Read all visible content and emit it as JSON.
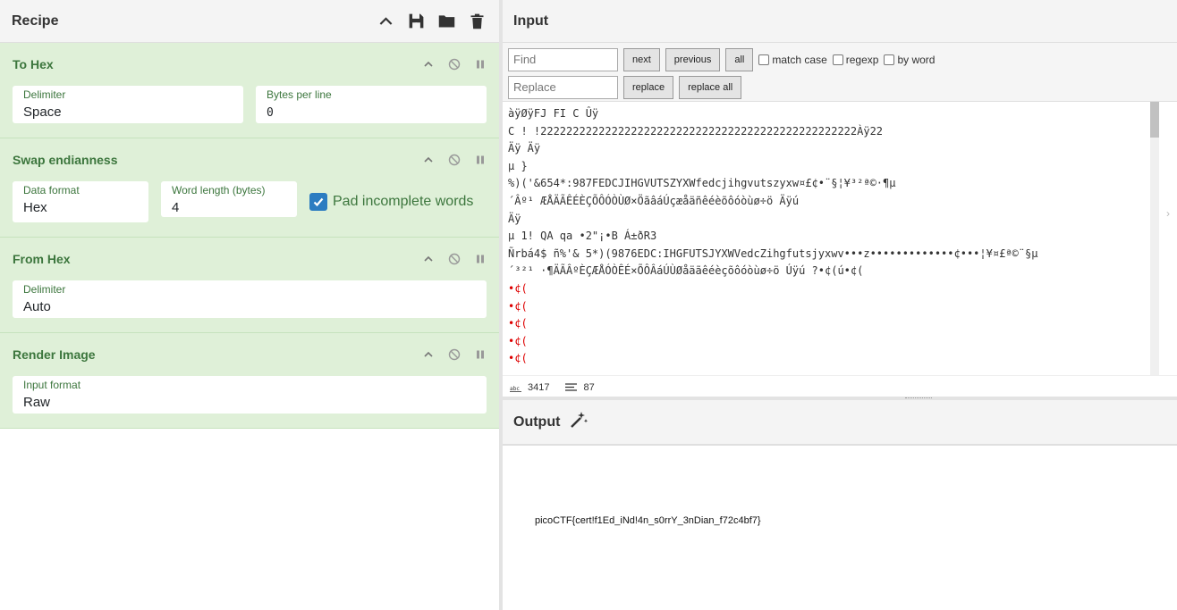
{
  "recipe": {
    "title": "Recipe",
    "icons": [
      "chevron-up-icon",
      "save-icon",
      "folder-icon",
      "trash-icon"
    ],
    "operations": [
      {
        "name": "To Hex",
        "args": [
          {
            "label": "Delimiter",
            "value": "Space"
          },
          {
            "label": "Bytes per line",
            "value": "0"
          }
        ]
      },
      {
        "name": "Swap endianness",
        "args": [
          {
            "label": "Data format",
            "value": "Hex"
          },
          {
            "label": "Word length (bytes)",
            "value": "4"
          }
        ],
        "checkbox": {
          "label": "Pad incomplete words",
          "checked": true
        }
      },
      {
        "name": "From Hex",
        "args": [
          {
            "label": "Delimiter",
            "value": "Auto"
          }
        ]
      },
      {
        "name": "Render Image",
        "args": [
          {
            "label": "Input format",
            "value": "Raw"
          }
        ]
      }
    ]
  },
  "input": {
    "title": "Input",
    "search": {
      "find_placeholder": "Find",
      "replace_placeholder": "Replace",
      "next": "next",
      "previous": "previous",
      "all": "all",
      "match_case": "match case",
      "regexp": "regexp",
      "by_word": "by word",
      "replace": "replace",
      "replace_all": "replace all"
    },
    "lines": [
      "àÿØÿFJ FI C Ûÿ",
      "C ! !2222222222222222222222222222222222222222222222222Àÿ22",
      "Äÿ Äÿ",
      "µ }",
      "%)('&654*:987FEDCJIHGVUTSZYXWfedcjihgvutszyxw¤£¢•¨§¦¥³²ª©·¶µ",
      "´Âº¹ ÆÅÄÃÊÉÈÇÕÔÓÒÙØ×ÖãâáÚçæåäñêéèõôóòùø÷ö Äÿú",
      "Äÿ",
      "µ 1! QA qa •2\"¡•B Á±ðR3",
      "Ñrbá4$ ñ%'& 5*)(9876EDC:IHGFUTSJYXWVedcZihgfutsjyxwv•••z•••••••••••••¢•••¦¥¤£ª©¨§µ",
      "´³²¹ ·¶ÄÃÂºÈÇÆÅÓÒÊÉ×ÕÔÂáÚÙØåäãêéèçõôóòùø÷ö Úÿú ?•¢(ú•¢(",
      "•¢(",
      "•¢(",
      "•¢(",
      "•¢(",
      "•¢("
    ],
    "status": {
      "length": "3417",
      "lines": "87"
    }
  },
  "output": {
    "title": "Output",
    "text": "picoCTF{cert!f1Ed_iNd!4n_s0rrY_3nDian_f72c4bf7}"
  },
  "colors": {
    "op_bg": "#dff0d8",
    "op_text": "#3c763d",
    "accent": "#2c7cc1",
    "control_char": "#dd0000"
  }
}
